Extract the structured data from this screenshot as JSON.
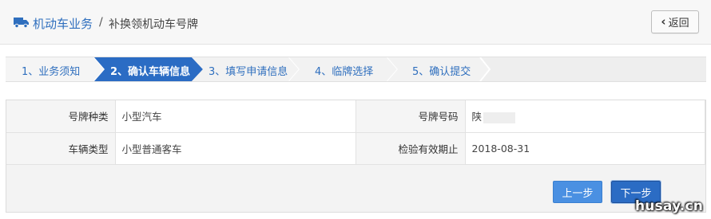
{
  "header": {
    "section_title": "机动车业务",
    "separator": "/",
    "page_title": "补换领机动车号牌",
    "back_label": "返回",
    "icons": {
      "section": "truck-icon",
      "back": "chevron-left-icon"
    }
  },
  "steps": [
    {
      "label": "1、业务须知",
      "active": false
    },
    {
      "label": "2、确认车辆信息",
      "active": true
    },
    {
      "label": "3、填写申请信息",
      "active": false
    },
    {
      "label": "4、临牌选择",
      "active": false
    },
    {
      "label": "5、确认提交",
      "active": false
    }
  ],
  "vehicle_info": {
    "plate_type_label": "号牌种类",
    "plate_type_value": "小型汽车",
    "plate_number_label": "号牌号码",
    "plate_number_value": "陕",
    "vehicle_type_label": "车辆类型",
    "vehicle_type_value": "小型普通客车",
    "inspection_label": "检验有效期止",
    "inspection_value": "2018-08-31"
  },
  "actions": {
    "prev_label": "上一步",
    "next_label": "下一步"
  },
  "watermark": "husay.cn",
  "colors": {
    "accent": "#2f6fbe",
    "active_step": "#2b6cc4",
    "button": "#4a90e2"
  }
}
